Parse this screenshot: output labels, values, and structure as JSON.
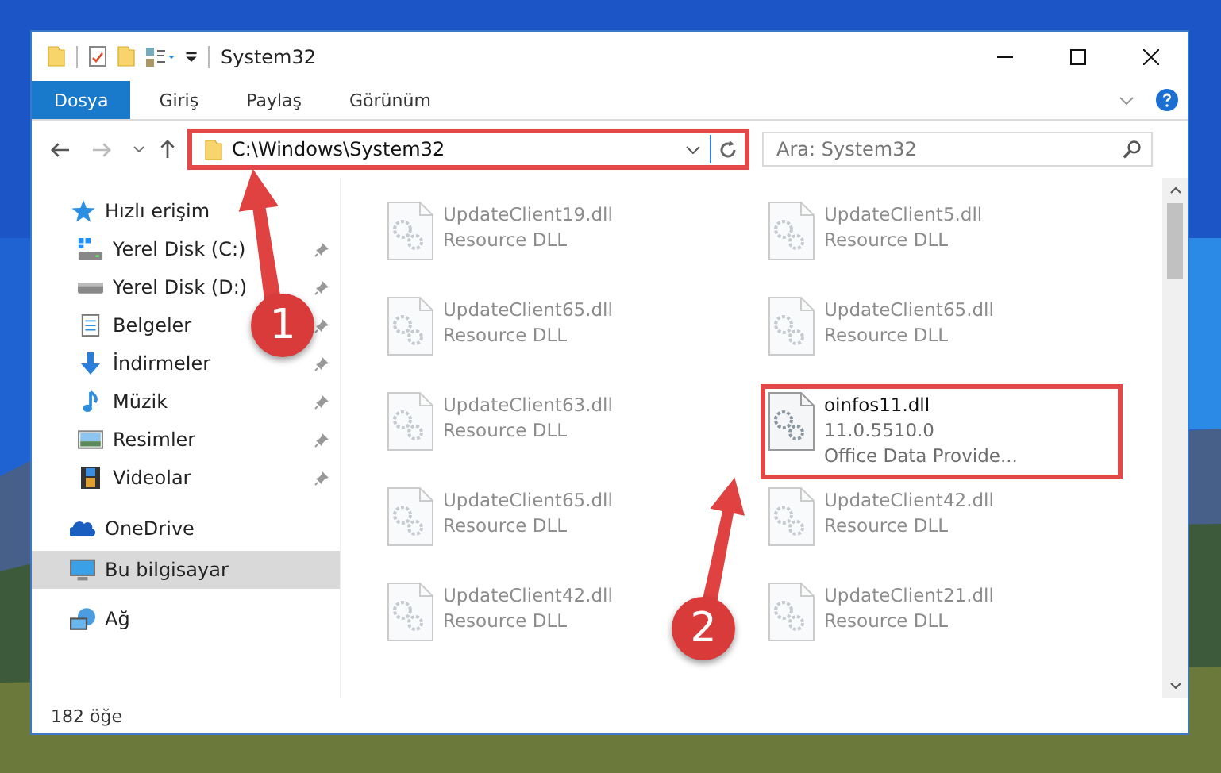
{
  "window": {
    "title": "System32"
  },
  "ribbon_tabs": [
    {
      "label": "Dosya",
      "selected": true
    },
    {
      "label": "Giriş",
      "selected": false
    },
    {
      "label": "Paylaş",
      "selected": false
    },
    {
      "label": "Görünüm",
      "selected": false
    }
  ],
  "address_bar": {
    "path": "C:\\Windows\\System32",
    "highlighted": true
  },
  "search": {
    "placeholder": "Ara: System32"
  },
  "sidebar": {
    "items": [
      {
        "label": "Hızlı erişim",
        "kind": "star",
        "selected": false,
        "children": [
          {
            "label": "Yerel Disk (C:)",
            "kind": "system-drive",
            "pinned": true,
            "selected": false
          },
          {
            "label": "Yerel Disk (D:)",
            "kind": "drive",
            "pinned": true,
            "selected": false
          },
          {
            "label": "Belgeler",
            "kind": "document",
            "pinned": true,
            "selected": false
          },
          {
            "label": "İndirmeler",
            "kind": "download",
            "pinned": true,
            "selected": false
          },
          {
            "label": "Müzik",
            "kind": "music",
            "pinned": true,
            "selected": false
          },
          {
            "label": "Resimler",
            "kind": "pictures",
            "pinned": true,
            "selected": false
          },
          {
            "label": "Videolar",
            "kind": "videos",
            "pinned": true,
            "selected": false
          }
        ]
      },
      {
        "label": "OneDrive",
        "kind": "cloud",
        "selected": false
      },
      {
        "label": "Bu bilgisayar",
        "kind": "computer",
        "selected": true
      },
      {
        "label": "Ağ",
        "kind": "network",
        "selected": false
      }
    ]
  },
  "files": [
    {
      "name": "UpdateClient19.dll",
      "details": [
        "Resource DLL"
      ],
      "faded": true,
      "highlighted": false
    },
    {
      "name": "UpdateClient5.dll",
      "details": [
        "Resource DLL"
      ],
      "faded": true,
      "highlighted": false
    },
    {
      "name": "UpdateClient65.dll",
      "details": [
        "Resource DLL"
      ],
      "faded": true,
      "highlighted": false
    },
    {
      "name": "UpdateClient65.dll",
      "details": [
        "Resource DLL"
      ],
      "faded": true,
      "highlighted": false
    },
    {
      "name": "UpdateClient63.dll",
      "details": [
        "Resource DLL"
      ],
      "faded": true,
      "highlighted": false
    },
    {
      "name": "oinfos11.dll",
      "details": [
        "11.0.5510.0",
        "Office Data Provide..."
      ],
      "faded": false,
      "highlighted": true
    },
    {
      "name": "UpdateClient65.dll",
      "details": [
        "Resource DLL"
      ],
      "faded": true,
      "highlighted": false
    },
    {
      "name": "UpdateClient42.dll",
      "details": [
        "Resource DLL"
      ],
      "faded": true,
      "highlighted": false
    },
    {
      "name": "UpdateClient42.dll",
      "details": [
        "Resource DLL"
      ],
      "faded": true,
      "highlighted": false
    },
    {
      "name": "UpdateClient21.dll",
      "details": [
        "Resource DLL"
      ],
      "faded": true,
      "highlighted": false
    }
  ],
  "annotations": [
    {
      "label": "1"
    },
    {
      "label": "2"
    }
  ],
  "status_bar": {
    "item_count": "182 öğe"
  }
}
